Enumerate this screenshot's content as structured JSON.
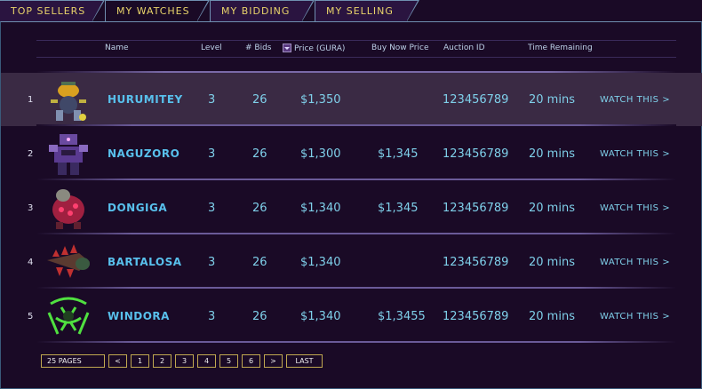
{
  "tabs": [
    {
      "label": "TOP SELLERS"
    },
    {
      "label": "MY WATCHES"
    },
    {
      "label": "MY BIDDING"
    },
    {
      "label": "MY SELLING"
    }
  ],
  "columns": {
    "name": "Name",
    "level": "Level",
    "bids": "# Bids",
    "price": "Price (GURA)",
    "buynow": "Buy Now Price",
    "auction": "Auction ID",
    "time": "Time Remaining"
  },
  "rows": [
    {
      "rank": "1",
      "name": "HURUMITEY",
      "level": "3",
      "bids": "26",
      "price": "$1,350",
      "buynow": "",
      "auction": "123456789",
      "time": "20 mins",
      "watch": "WATCH THIS >",
      "thumb_icon": "yellow-robot-creature-icon"
    },
    {
      "rank": "2",
      "name": "NAGUZORO",
      "level": "3",
      "bids": "26",
      "price": "$1,300",
      "buynow": "$1,345",
      "auction": "123456789",
      "time": "20 mins",
      "watch": "WATCH THIS >",
      "thumb_icon": "purple-mech-creature-icon"
    },
    {
      "rank": "3",
      "name": "DONGIGA",
      "level": "3",
      "bids": "26",
      "price": "$1,340",
      "buynow": "$1,345",
      "auction": "123456789",
      "time": "20 mins",
      "watch": "WATCH THIS >",
      "thumb_icon": "red-beast-creature-icon"
    },
    {
      "rank": "4",
      "name": "BARTALOSA",
      "level": "3",
      "bids": "26",
      "price": "$1,340",
      "buynow": "",
      "auction": "123456789",
      "time": "20 mins",
      "watch": "WATCH THIS >",
      "thumb_icon": "spiked-drill-creature-icon"
    },
    {
      "rank": "5",
      "name": "WINDORA",
      "level": "3",
      "bids": "26",
      "price": "$1,340",
      "buynow": "$1,3455",
      "auction": "123456789",
      "time": "20 mins",
      "watch": "WATCH THIS >",
      "thumb_icon": "green-wireframe-creature-icon"
    }
  ],
  "pager": {
    "pages": "25 PAGES",
    "prev": "<",
    "numbers": [
      "1",
      "2",
      "3",
      "4",
      "5",
      "6"
    ],
    "next": ">",
    "last": "LAST"
  },
  "colors": {
    "background": "#1a0a26",
    "tab_text": "#e8d36a",
    "name_text": "#58c0ec",
    "value_text": "#7fd0ea",
    "highlight_row": "#3a2a44",
    "pager_border": "#c0a850"
  }
}
